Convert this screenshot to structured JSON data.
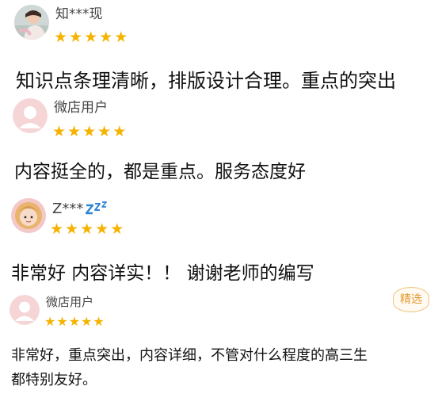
{
  "reviews": [
    {
      "user": "知***现",
      "stars": [
        "★",
        "★",
        "★",
        "★",
        "★"
      ],
      "comment": "知识点条理清晰，排版设计合理。重点的突出",
      "avatar_icon": "photo-avatar-icon"
    },
    {
      "user": "微店用户",
      "stars": [
        "★",
        "★",
        "★",
        "★",
        "★"
      ],
      "comment": "内容挺全的，都是重点。服务态度好",
      "avatar_icon": "default-avatar-icon"
    },
    {
      "user": "Z***",
      "stars": [
        "★",
        "★",
        "★",
        "★",
        "★"
      ],
      "comment": "非常好 内容详实！！ 谢谢老师的编写",
      "avatar_icon": "photo-avatar-icon",
      "user_suffix_icon": "sleep-zzz-icon"
    },
    {
      "user": "微店用户",
      "stars": [
        "★",
        "★",
        "★",
        "★",
        "★"
      ],
      "comment_lines": [
        "非常好，重点突出，内容详细，不管对什么程度的高三生",
        "都特别友好。"
      ],
      "badge": "精选",
      "avatar_icon": "default-avatar-icon"
    }
  ],
  "colors": {
    "star": "#f5b301",
    "badge": "#e39a2d",
    "avatar_default": "#f5d5d5"
  }
}
